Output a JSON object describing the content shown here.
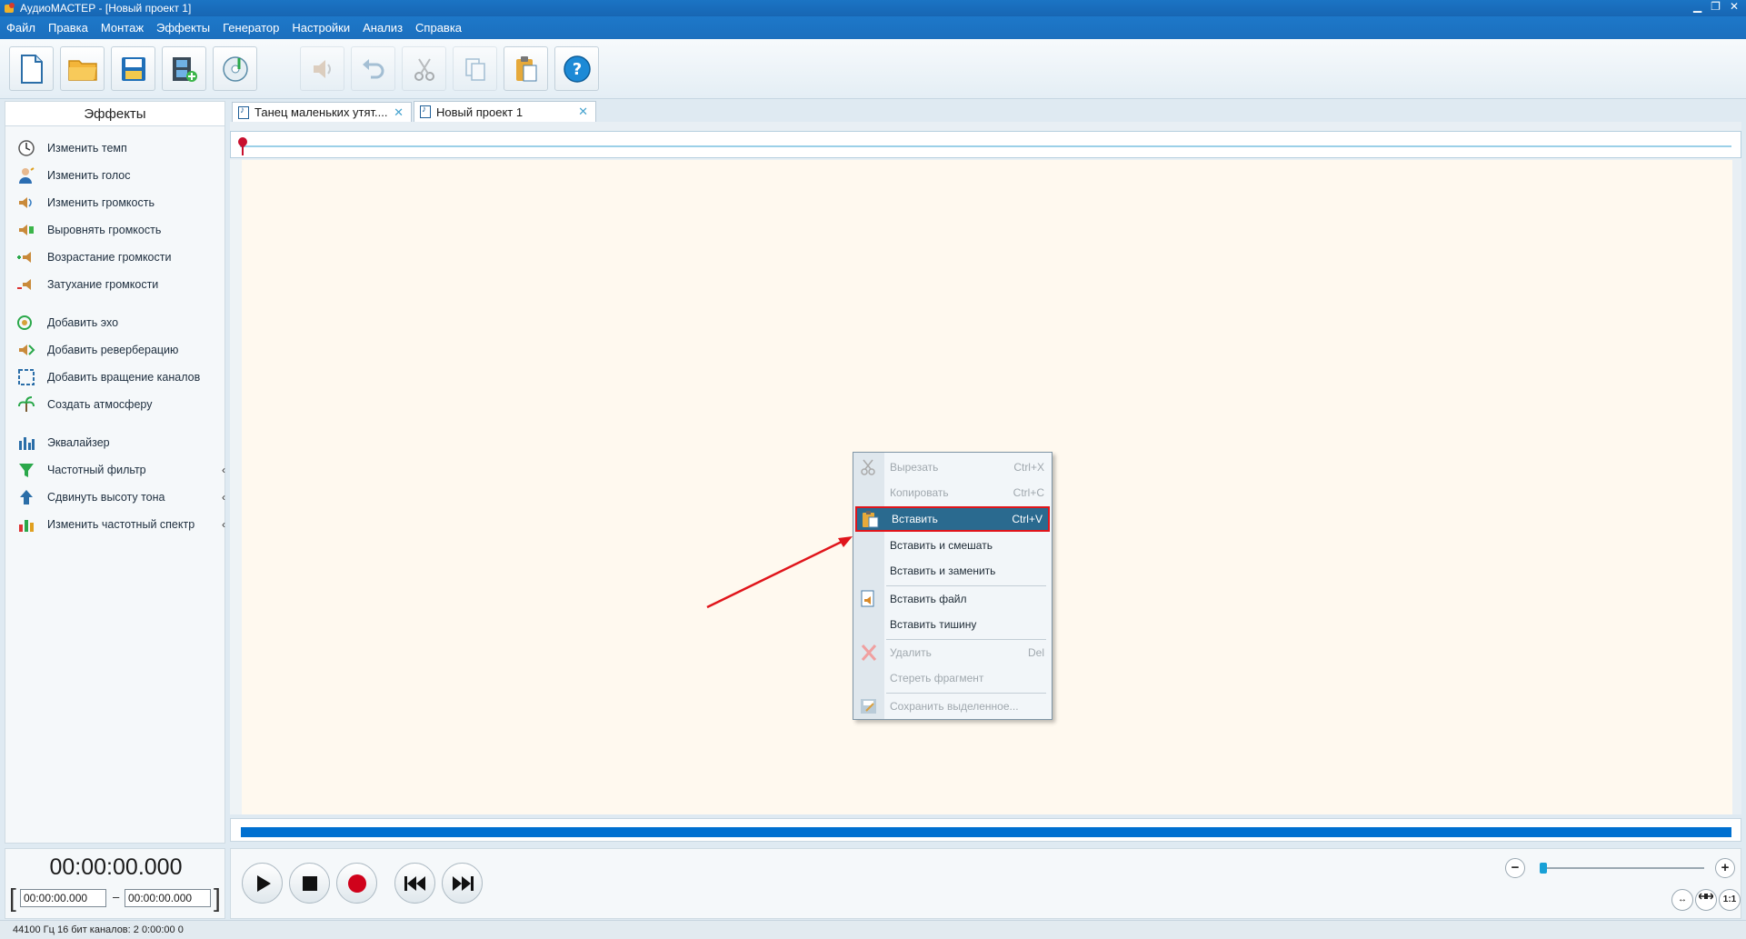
{
  "window": {
    "title": "АудиоМАСТЕР - [Новый проект 1]"
  },
  "menu": [
    "Файл",
    "Правка",
    "Монтаж",
    "Эффекты",
    "Генератор",
    "Настройки",
    "Анализ",
    "Справка"
  ],
  "toolbar": [
    {
      "name": "new-file",
      "icon": "new-file-icon",
      "enabled": true
    },
    {
      "name": "open-folder",
      "icon": "folder-icon",
      "enabled": true
    },
    {
      "name": "save",
      "icon": "save-icon",
      "enabled": true
    },
    {
      "name": "add-video",
      "icon": "film-icon",
      "enabled": true
    },
    {
      "name": "import-cd",
      "icon": "cd-icon",
      "enabled": true
    },
    {
      "name": "volume",
      "icon": "speaker-icon",
      "enabled": false
    },
    {
      "name": "undo",
      "icon": "undo-icon",
      "enabled": false
    },
    {
      "name": "cut",
      "icon": "scissors-icon",
      "enabled": false
    },
    {
      "name": "copy",
      "icon": "copy-icon",
      "enabled": false
    },
    {
      "name": "paste",
      "icon": "clipboard-icon",
      "enabled": true
    },
    {
      "name": "help",
      "icon": "help-icon",
      "enabled": true
    }
  ],
  "effects_panel": {
    "title": "Эффекты",
    "items": [
      {
        "label": "Изменить темп",
        "icon": "clock-icon",
        "submenu": false
      },
      {
        "label": "Изменить голос",
        "icon": "person-voice-icon",
        "submenu": false
      },
      {
        "label": "Изменить громкость",
        "icon": "volume-icon",
        "submenu": false
      },
      {
        "label": "Выровнять громкость",
        "icon": "volume-level-icon",
        "submenu": false
      },
      {
        "label": "Возрастание громкости",
        "icon": "volume-up-icon",
        "submenu": false
      },
      {
        "label": "Затухание громкости",
        "icon": "volume-down-icon",
        "submenu": false
      },
      {
        "label": "Добавить эхо",
        "icon": "echo-icon",
        "submenu": false
      },
      {
        "label": "Добавить реверберацию",
        "icon": "reverb-icon",
        "submenu": false
      },
      {
        "label": "Добавить вращение каналов",
        "icon": "rotate-channels-icon",
        "submenu": false
      },
      {
        "label": "Создать атмосферу",
        "icon": "atmosphere-icon",
        "submenu": false
      },
      {
        "label": "Эквалайзер",
        "icon": "equalizer-icon",
        "submenu": false
      },
      {
        "label": "Частотный фильтр",
        "icon": "funnel-icon",
        "submenu": true
      },
      {
        "label": "Сдвинуть высоту тона",
        "icon": "pitch-up-icon",
        "submenu": true
      },
      {
        "label": "Изменить частотный спектр",
        "icon": "spectrum-icon",
        "submenu": true
      }
    ]
  },
  "tabs": [
    {
      "label": "Танец маленьких утят....",
      "active": false
    },
    {
      "label": "Новый проект 1",
      "active": true
    }
  ],
  "time": {
    "current": "00:00:00.000",
    "range_start": "00:00:00.000",
    "range_sep": "–",
    "range_end": "00:00:00.000"
  },
  "transport": {
    "zoom_out": "−",
    "zoom_in": "+",
    "fit_label": "↔",
    "one_to_one": "1:1"
  },
  "status": "44100 Гц  16 бит  каналов: 2   0:00:00 0",
  "context_menu": {
    "items": [
      {
        "label": "Вырезать",
        "shortcut": "Ctrl+X",
        "enabled": false,
        "icon": "scissors-icon"
      },
      {
        "label": "Копировать",
        "shortcut": "Ctrl+C",
        "enabled": false,
        "icon": ""
      },
      {
        "label": "Вставить",
        "shortcut": "Ctrl+V",
        "enabled": true,
        "highlighted": true,
        "icon": "clipboard-icon"
      },
      {
        "label": "Вставить и смешать",
        "shortcut": "",
        "enabled": true,
        "icon": ""
      },
      {
        "label": "Вставить и заменить",
        "shortcut": "",
        "enabled": true,
        "icon": ""
      },
      {
        "label": "Вставить файл",
        "shortcut": "",
        "enabled": true,
        "icon": "insert-file-icon"
      },
      {
        "label": "Вставить тишину",
        "shortcut": "",
        "enabled": true,
        "icon": ""
      },
      {
        "label": "Удалить",
        "shortcut": "Del",
        "enabled": false,
        "icon": "delete-x-icon"
      },
      {
        "label": "Стереть фрагмент",
        "shortcut": "",
        "enabled": false,
        "icon": ""
      },
      {
        "label": "Сохранить выделенное...",
        "shortcut": "",
        "enabled": false,
        "icon": "save-selection-icon"
      }
    ]
  },
  "colors": {
    "title_bar": "#1b74c4",
    "canvas_bg": "#fff9ef",
    "highlight": "#2a6a8f",
    "highlight_border": "#e0151b",
    "annotation_arrow": "#e0151b",
    "progress": "#0070d0"
  }
}
